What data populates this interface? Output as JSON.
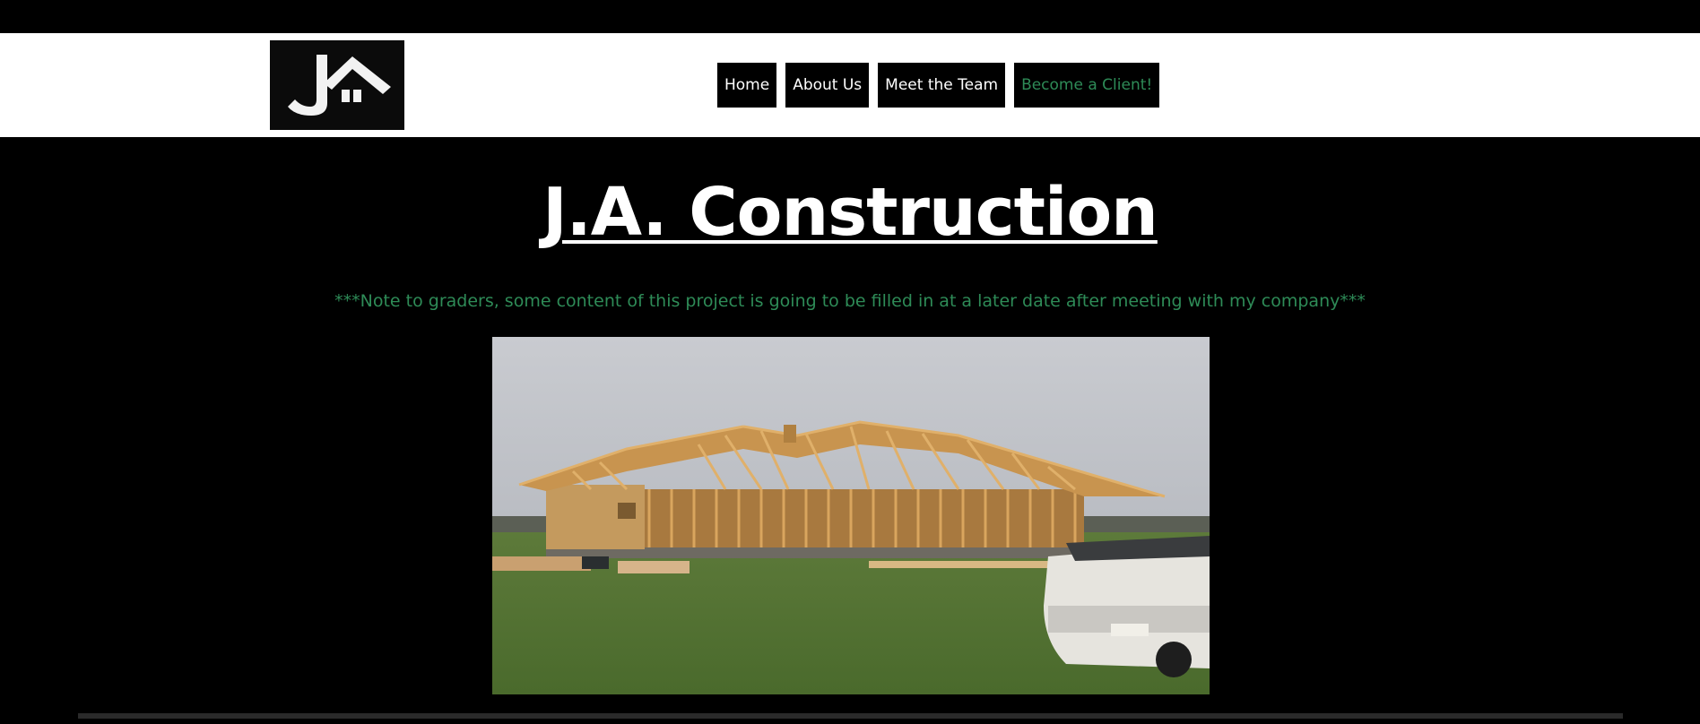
{
  "site": {
    "logo_alt": "J.A. Construction logo"
  },
  "nav": {
    "items": [
      {
        "label": "Home"
      },
      {
        "label": "About Us"
      },
      {
        "label": "Meet the Team"
      },
      {
        "label": "Become a Client!"
      }
    ]
  },
  "main": {
    "title": "J.A. Construction",
    "note": "***Note to graders, some content of this project is going to be filled in at a later date after meeting with my company***",
    "hero_image_alt": "House under construction with wooden framing and a pickup truck"
  },
  "colors": {
    "background": "#000000",
    "header_bg": "#ffffff",
    "accent_green": "#2e8b57",
    "text": "#ffffff"
  }
}
